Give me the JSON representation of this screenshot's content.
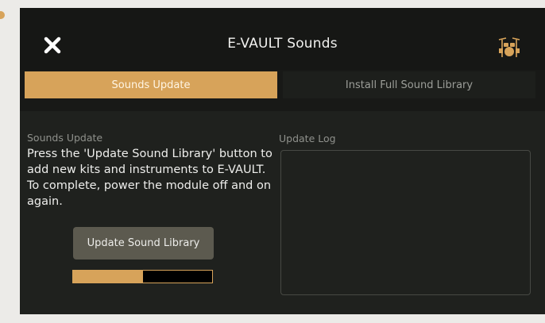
{
  "window": {
    "title": "E-VAULT Sounds"
  },
  "icons": {
    "close": "close-x-icon",
    "drums": "drum-kit-icon"
  },
  "tabs": [
    {
      "label": "Sounds Update",
      "active": true
    },
    {
      "label": "Install Full Sound Library",
      "active": false
    }
  ],
  "update": {
    "section_label": "Sounds Update",
    "description": "Press the 'Update Sound Library' button to add new kits and instruments to E-VAULT. To complete, power the module off and on again.",
    "button_label": "Update Sound Library",
    "progress_percent": 50
  },
  "log": {
    "label": "Update Log",
    "content": ""
  },
  "colors": {
    "accent": "#d7a35a",
    "panel": "#1f211e",
    "titlebar": "#161715",
    "button": "#5c5a4f"
  }
}
